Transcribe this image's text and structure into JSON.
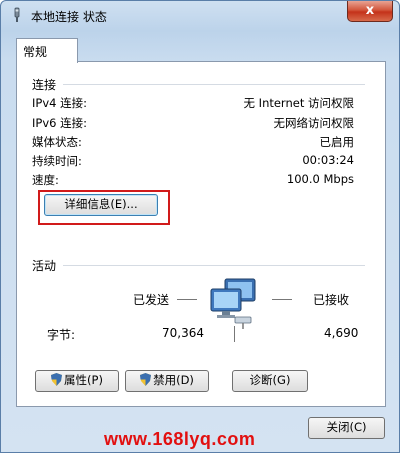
{
  "window": {
    "title": "本地连接 状态",
    "close_glyph": "x"
  },
  "tabs": [
    {
      "label": "常规",
      "active": true
    }
  ],
  "connection": {
    "header": "连接",
    "rows": [
      {
        "label": "IPv4 连接:",
        "value": "无 Internet 访问权限"
      },
      {
        "label": "IPv6 连接:",
        "value": "无网络访问权限"
      },
      {
        "label": "媒体状态:",
        "value": "已启用"
      },
      {
        "label": "持续时间:",
        "value": "00:03:24"
      },
      {
        "label": "速度:",
        "value": "100.0 Mbps"
      }
    ],
    "details_button": "详细信息(E)..."
  },
  "activity": {
    "header": "活动",
    "sent_label": "已发送",
    "received_label": "已接收",
    "bytes_label": "字节:",
    "bytes_sent": "70,364",
    "bytes_received": "4,690"
  },
  "buttons": {
    "properties": "属性(P)",
    "disable": "禁用(D)",
    "diagnose": "诊断(G)",
    "close": "关闭(C)"
  },
  "watermark": "www.168lyq.com",
  "colors": {
    "highlight": "#d11a1a",
    "watermark": "#e21010",
    "titlebar": "#bcd3ea"
  },
  "icons": {
    "title": "network-connection-icon",
    "activity": "network-computers-icon",
    "shield": "uac-shield-icon"
  }
}
